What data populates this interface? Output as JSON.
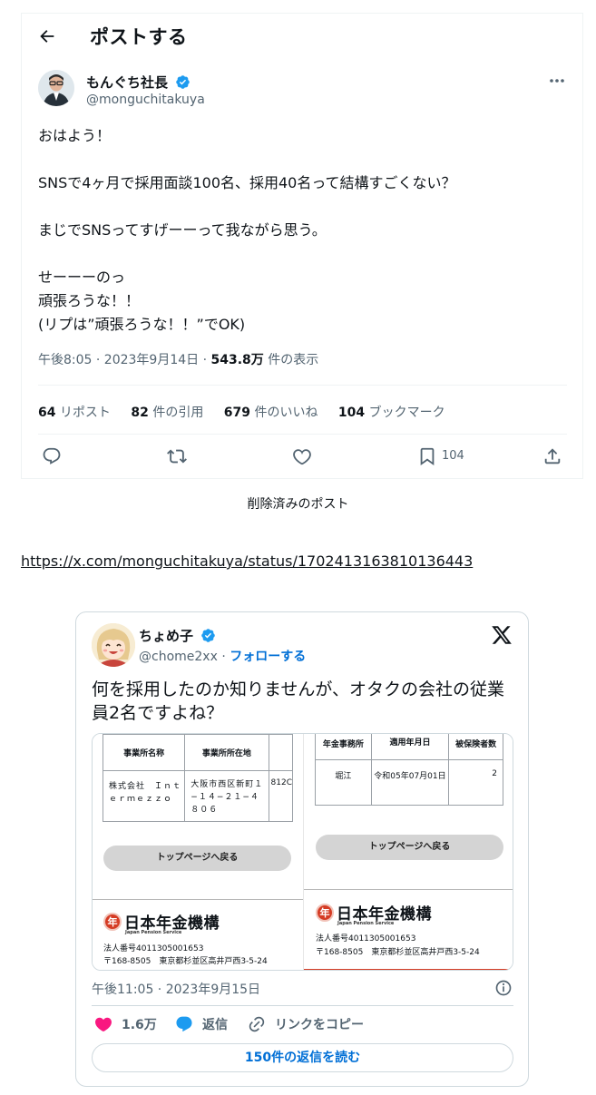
{
  "post": {
    "header_title": "ポストする",
    "author": {
      "name": "もんぐち社長",
      "handle": "@monguchitakuya"
    },
    "body": "おはよう！\n\nSNSで4ヶ月で採用面談100名、採用40名って結構すごくない？\n\nまじでSNSってすげーーって我ながら思う。\n\nせーーーのっ\n頑張ろうな！！\n(リプは”頑張ろうな！！”でOK)",
    "timestamp": "午後8:05 · 2023年9月14日 · ",
    "views_count": "543.8万",
    "views_label": " 件の表示",
    "stats": [
      {
        "count": "64",
        "label": " リポスト"
      },
      {
        "count": "82",
        "label": " 件の引用"
      },
      {
        "count": "679",
        "label": " 件のいいね"
      },
      {
        "count": "104",
        "label": " ブックマーク"
      }
    ],
    "bookmark_count": "104"
  },
  "deleted_label": "削除済みのポスト",
  "link_url": "https://x.com/monguchitakuya/status/1702413163810136443",
  "embed": {
    "author": {
      "name": "ちょめ子",
      "handle": "@chome2xx",
      "separator": " · ",
      "follow_label": "フォローする"
    },
    "body": "何を採用したのか知りませんが、オタクの会社の従業員2名ですよね？",
    "timestamp": "午後11:05 · 2023年9月15日",
    "likes": "1.6万",
    "reply_label": "返信",
    "copy_link_label": "リンクをコピー",
    "read_replies_label": "150件の返信を読む",
    "media": {
      "left": {
        "col1": "事業所名称",
        "col2": "事業所所在地",
        "cell1": "株式会社　Ｉｎｔｅｒｍｅｚｚｏ",
        "cell2": "大阪市西区新町１−１４−２１−４８０６",
        "cell3": "812C",
        "button": "トップページへ戻る"
      },
      "right": {
        "col1": "年金事務所",
        "col2": "適用年月日",
        "col3": "被保険者数",
        "cell1": "堀江",
        "cell2": "令和05年07月01日",
        "cell3": "2",
        "button": "トップページへ戻る"
      },
      "org_name": "日本年金機構",
      "org_seal": "年",
      "org_en": "Japan Pension Service",
      "corp_number": "法人番号4011305001653",
      "address": "〒168-8505　東京都杉並区高井戸西3-5-24"
    }
  },
  "colors": {
    "accent": "#1d9bf0",
    "like": "#f91880",
    "text_secondary": "#536471",
    "brand_red": "#d53b24"
  },
  "icons": [
    "back-arrow-icon",
    "verified-badge-icon",
    "more-icon",
    "reply-icon",
    "repost-icon",
    "like-icon",
    "bookmark-icon",
    "share-icon",
    "x-logo-icon",
    "info-icon",
    "heart-icon",
    "reply-bubble-icon",
    "link-icon"
  ]
}
